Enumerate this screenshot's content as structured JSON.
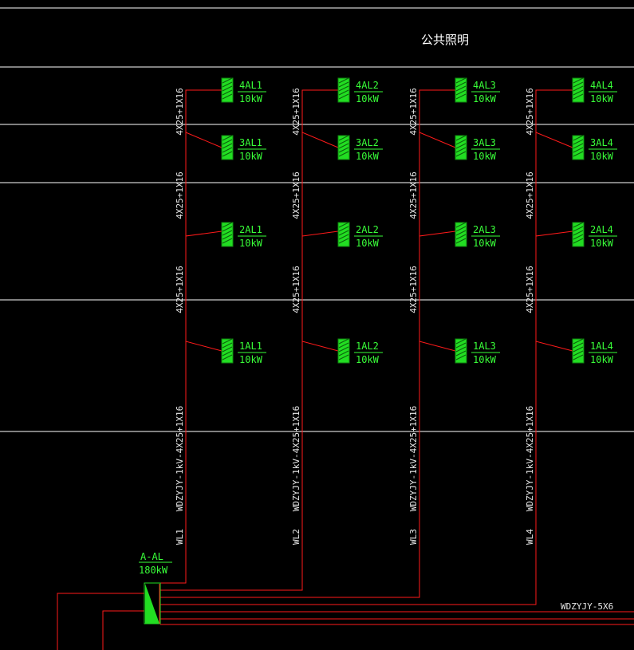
{
  "title": "公共照明",
  "main_panel": {
    "name": "A-AL",
    "power": "180kW"
  },
  "feeder_label": "WDZYJY-5X6",
  "columns": [
    {
      "circuit": "WL1",
      "riser_cable": "WDZYJY-1kV-4X25+1X16",
      "branch_cable": "4X25+1X16",
      "panels": [
        {
          "name": "1AL1",
          "power": "10kW"
        },
        {
          "name": "2AL1",
          "power": "10kW"
        },
        {
          "name": "3AL1",
          "power": "10kW"
        },
        {
          "name": "4AL1",
          "power": "10kW"
        }
      ]
    },
    {
      "circuit": "WL2",
      "riser_cable": "WDZYJY-1kV-4X25+1X16",
      "branch_cable": "4X25+1X16",
      "panels": [
        {
          "name": "1AL2",
          "power": "10kW"
        },
        {
          "name": "2AL2",
          "power": "10kW"
        },
        {
          "name": "3AL2",
          "power": "10kW"
        },
        {
          "name": "4AL2",
          "power": "10kW"
        }
      ]
    },
    {
      "circuit": "WL3",
      "riser_cable": "WDZYJY-1kV-4X25+1X16",
      "branch_cable": "4X25+1X16",
      "panels": [
        {
          "name": "1AL3",
          "power": "10kW"
        },
        {
          "name": "2AL3",
          "power": "10kW"
        },
        {
          "name": "3AL3",
          "power": "10kW"
        },
        {
          "name": "4AL3",
          "power": "10kW"
        }
      ]
    },
    {
      "circuit": "WL4",
      "riser_cable": "WDZYJY-1kV-4X25+1X16",
      "branch_cable": "4X25+1X16",
      "panels": [
        {
          "name": "1AL4",
          "power": "10kW"
        },
        {
          "name": "2AL4",
          "power": "10kW"
        },
        {
          "name": "3AL4",
          "power": "10kW"
        },
        {
          "name": "4AL4",
          "power": "10kW"
        }
      ]
    }
  ]
}
